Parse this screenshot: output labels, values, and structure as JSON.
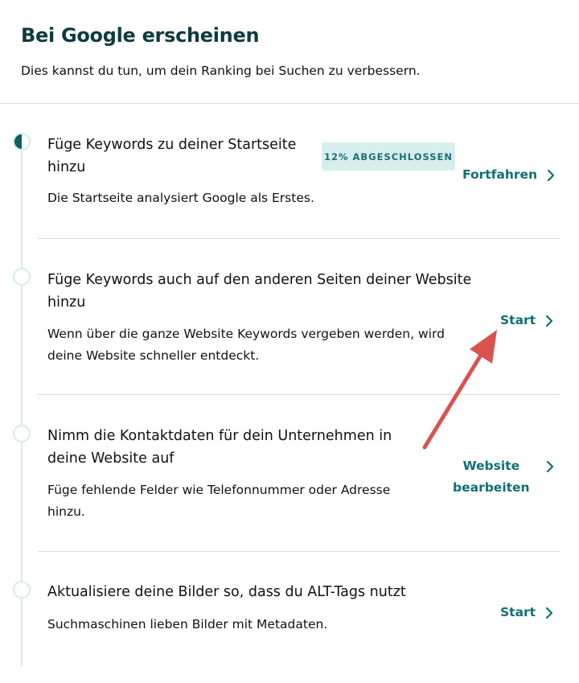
{
  "header": {
    "title": "Bei Google erscheinen",
    "subtitle": "Dies kannst du tun, um dein Ranking bei Suchen zu verbessern."
  },
  "steps": [
    {
      "title_line1": "Füge Keywords zu deiner Startseite",
      "title_line2": "hinzu",
      "description": "Die Startseite analysiert Google als Erstes.",
      "badge": "12% ABGESCHLOSSEN",
      "progress_percent": 12,
      "action": "Fortfahren",
      "state": "in-progress"
    },
    {
      "title_line1": "Füge Keywords auch auf den anderen Seiten deiner Website",
      "title_line2": "hinzu",
      "desc_line1": "Wenn über die ganze Website Keywords vergeben werden, wird",
      "desc_line2": "deine Website schneller entdeckt.",
      "action": "Start",
      "state": "not-started"
    },
    {
      "title_line1": "Nimm die Kontaktdaten für dein Unternehmen in",
      "title_line2": "deine Website auf",
      "desc_line1": "Füge fehlende Felder wie Telefonnummer oder Adresse",
      "desc_line2": "hinzu.",
      "action_line1": "Website",
      "action_line2": "bearbeiten",
      "state": "not-started"
    },
    {
      "title_line1": "Aktualisiere deine Bilder so, dass du ALT-Tags nutzt",
      "description": "Suchmaschinen lieben Bilder mit Metadaten.",
      "action": "Start",
      "state": "not-started"
    }
  ],
  "colors": {
    "heading": "#0f3b3f",
    "accent": "#0f6f73",
    "badge_bg": "#d6eeee",
    "timeline": "#d3ece9",
    "annotation_arrow": "#d9534f"
  },
  "icons": {
    "action_chevron": "chevron-right-icon",
    "annotation": "red-arrow-annotation"
  }
}
